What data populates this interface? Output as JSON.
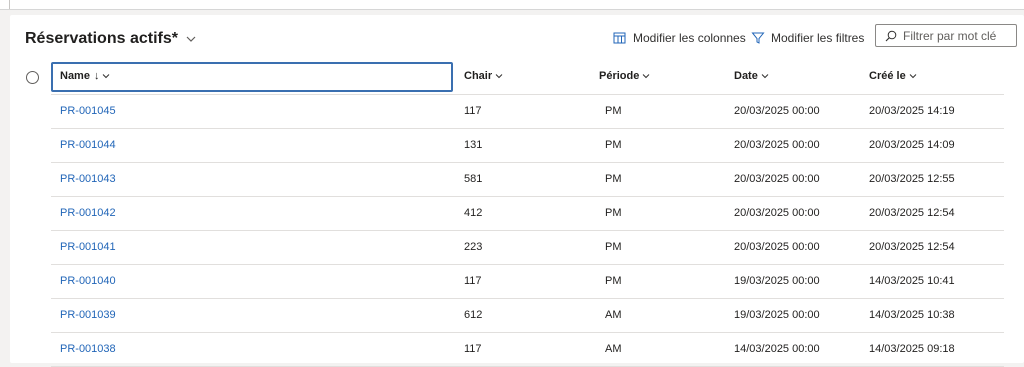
{
  "view": {
    "title": "Réservations actifs*"
  },
  "commands": {
    "edit_columns": "Modifier les colonnes",
    "edit_filters": "Modifier les filtres"
  },
  "search": {
    "placeholder": "Filtrer par mot clé"
  },
  "columns": [
    {
      "label": "Name",
      "sort_indicator": "↓"
    },
    {
      "label": "Chair"
    },
    {
      "label": "Période"
    },
    {
      "label": "Date"
    },
    {
      "label": "Créé le"
    }
  ],
  "rows": [
    {
      "name": "PR-001045",
      "chair": "117",
      "periode": "PM",
      "date": "20/03/2025 00:00",
      "cree_le": "20/03/2025 14:19"
    },
    {
      "name": "PR-001044",
      "chair": "131",
      "periode": "PM",
      "date": "20/03/2025 00:00",
      "cree_le": "20/03/2025 14:09"
    },
    {
      "name": "PR-001043",
      "chair": "581",
      "periode": "PM",
      "date": "20/03/2025 00:00",
      "cree_le": "20/03/2025 12:55"
    },
    {
      "name": "PR-001042",
      "chair": "412",
      "periode": "PM",
      "date": "20/03/2025 00:00",
      "cree_le": "20/03/2025 12:54"
    },
    {
      "name": "PR-001041",
      "chair": "223",
      "periode": "PM",
      "date": "20/03/2025 00:00",
      "cree_le": "20/03/2025 12:54"
    },
    {
      "name": "PR-001040",
      "chair": "117",
      "periode": "PM",
      "date": "19/03/2025 00:00",
      "cree_le": "14/03/2025 10:41"
    },
    {
      "name": "PR-001039",
      "chair": "612",
      "periode": "AM",
      "date": "19/03/2025 00:00",
      "cree_le": "14/03/2025 10:38"
    },
    {
      "name": "PR-001038",
      "chair": "117",
      "periode": "AM",
      "date": "14/03/2025 00:00",
      "cree_le": "14/03/2025 09:18"
    }
  ]
}
